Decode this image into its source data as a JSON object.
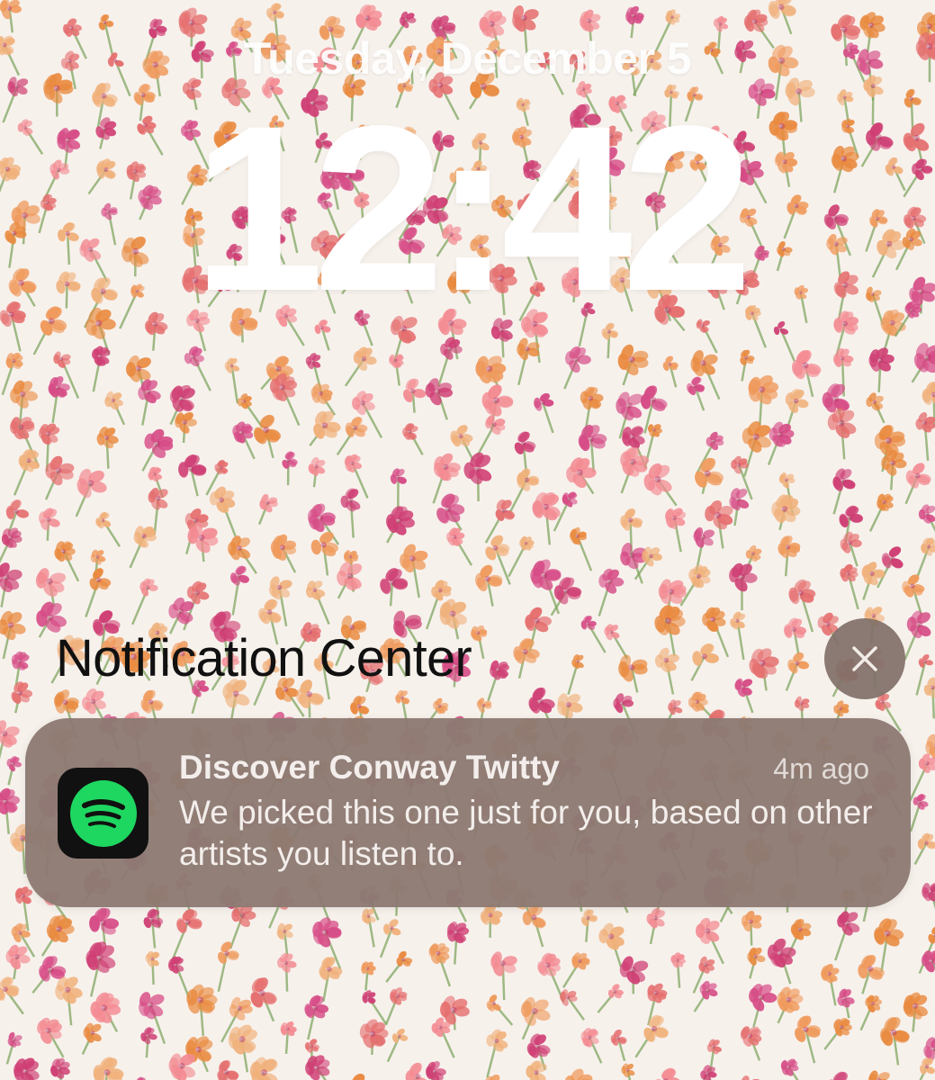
{
  "lock_screen": {
    "date": "Tuesday, December 5",
    "time": "12:42"
  },
  "notification_center": {
    "title": "Notification Center",
    "close_icon": "close-icon"
  },
  "notifications": [
    {
      "app_icon": "spotify-icon",
      "title": "Discover Conway Twitty",
      "time": "4m ago",
      "body": "We picked this one just for you, based on other artists you listen to."
    }
  ],
  "colors": {
    "spotify_green": "#1ED760",
    "notification_background": "#8C7A72",
    "close_button_background": "#807068"
  }
}
